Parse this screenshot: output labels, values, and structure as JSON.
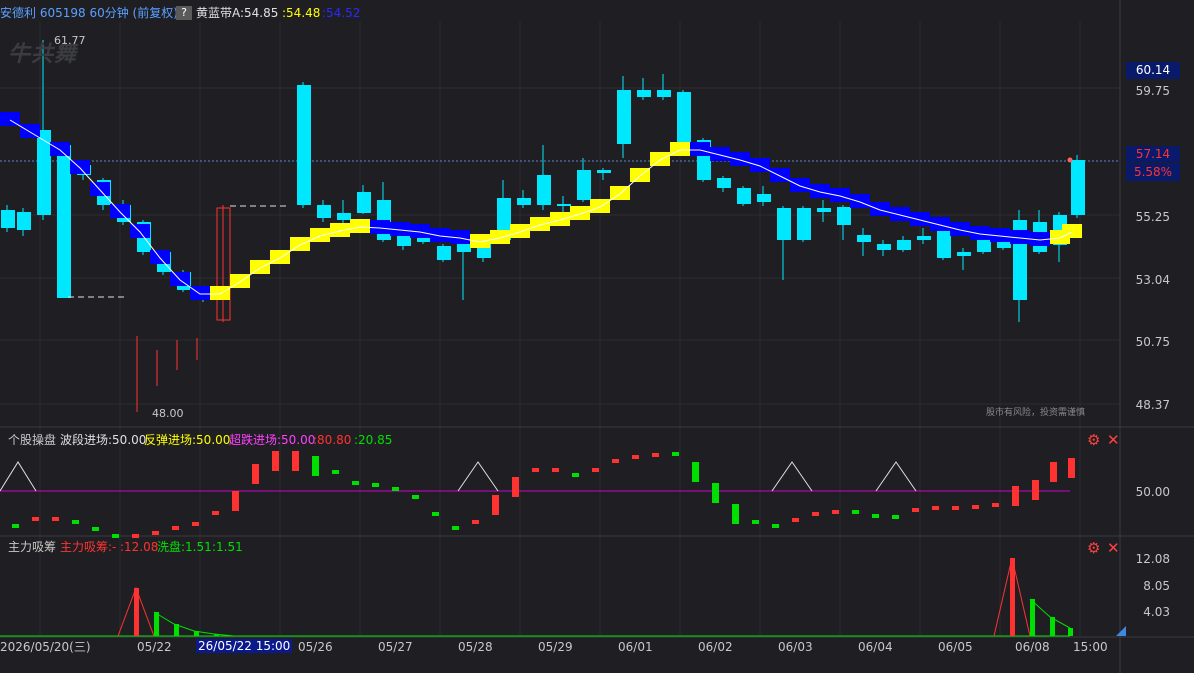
{
  "main": {
    "stock_title": "安德利 605198 60分钟 (前复权)",
    "help_label": "?",
    "indicator_name": "黄蓝带",
    "indicator_a": "A:54.85",
    "indicator_b": ":54.48",
    "indicator_c": ":54.52",
    "watermark": "牛共舞",
    "high_label": "61.77",
    "low_label": "48.00",
    "axis_labels": [
      "59.75",
      "55.25",
      "53.04",
      "50.75",
      "48.37"
    ],
    "price_top": "60.14",
    "price_current": "57.14",
    "price_pct": "5.58%",
    "disclaimer": "股市有风险，投资需谨慎"
  },
  "panel2": {
    "name": "个股操盘",
    "wave_label": "波段进场:50.00",
    "rebound_label": "反弹进场:50.00",
    "oversold_label": "超跌进场:50.00",
    "value_red": ":80.80",
    "value_green": ":20.85",
    "axis_label": "50.00"
  },
  "panel3": {
    "name": "主力吸筹",
    "main_label": "主力吸筹:-",
    "main_value": ":12.08",
    "wash_label": "洗盘:1.51",
    "wash_value": ":1.51",
    "axis_labels": [
      "12.08",
      "8.05",
      "4.03"
    ]
  },
  "time_axis": {
    "labels": [
      "2026/05/20(三)",
      "05/22",
      "26/05/22 15:00",
      "05/26",
      "05/27",
      "05/28",
      "05/29",
      "06/01",
      "06/02",
      "06/03",
      "06/04",
      "06/05",
      "06/08",
      "15:00"
    ]
  },
  "colors": {
    "up": "#ff3232",
    "down": "#00e8ff",
    "yellow_band": "#ffff00",
    "blue_band": "#0000ff",
    "magenta_line": "#c800c8",
    "green_bar": "#00e000",
    "title_blue": "#5aa0ff"
  }
}
